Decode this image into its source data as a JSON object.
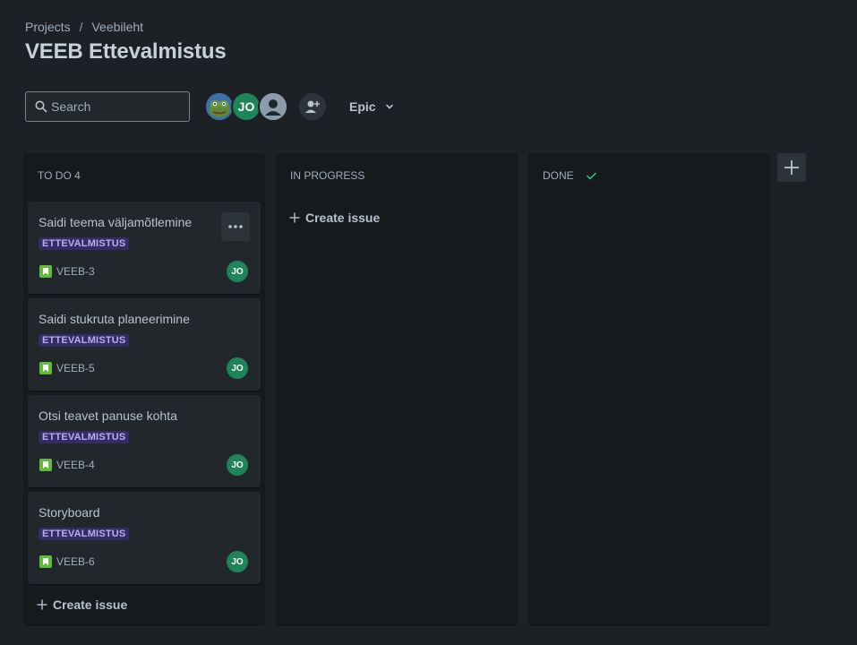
{
  "breadcrumb": {
    "projects": "Projects",
    "separator": "/",
    "project": "Veebileht"
  },
  "page_title": "VEEB Ettevalmistus",
  "search": {
    "placeholder": "Search",
    "value": ""
  },
  "avatars": {
    "user2_initials": "JO"
  },
  "epic_filter": {
    "label": "Epic"
  },
  "columns": {
    "todo": {
      "title": "TO DO 4"
    },
    "progress": {
      "title": "IN PROGRESS"
    },
    "done": {
      "title": "DONE"
    }
  },
  "cards": [
    {
      "title": "Saidi teema väljamõtlemine",
      "label": "ETTEVALMISTUS",
      "key": "VEEB-3",
      "assignee": "JO"
    },
    {
      "title": "Saidi stukruta planeerimine",
      "label": "ETTEVALMISTUS",
      "key": "VEEB-5",
      "assignee": "JO"
    },
    {
      "title": "Otsi teavet panuse kohta",
      "label": "ETTEVALMISTUS",
      "key": "VEEB-4",
      "assignee": "JO"
    },
    {
      "title": "Storyboard",
      "label": "ETTEVALMISTUS",
      "key": "VEEB-6",
      "assignee": "JO"
    }
  ],
  "create_issue_label": "Create issue",
  "colors": {
    "background": "#1d2125",
    "column": "#161a1d",
    "card": "#22272b",
    "label_bg": "#352c63",
    "label_text": "#b8acf6",
    "story": "#63ba3c",
    "avatar": "#1f845a",
    "done_check": "#2abb7f"
  },
  "icons": [
    "search-icon",
    "add-person-icon",
    "chevron-down-icon",
    "more-icon",
    "story-icon",
    "plus-icon",
    "check-icon"
  ]
}
